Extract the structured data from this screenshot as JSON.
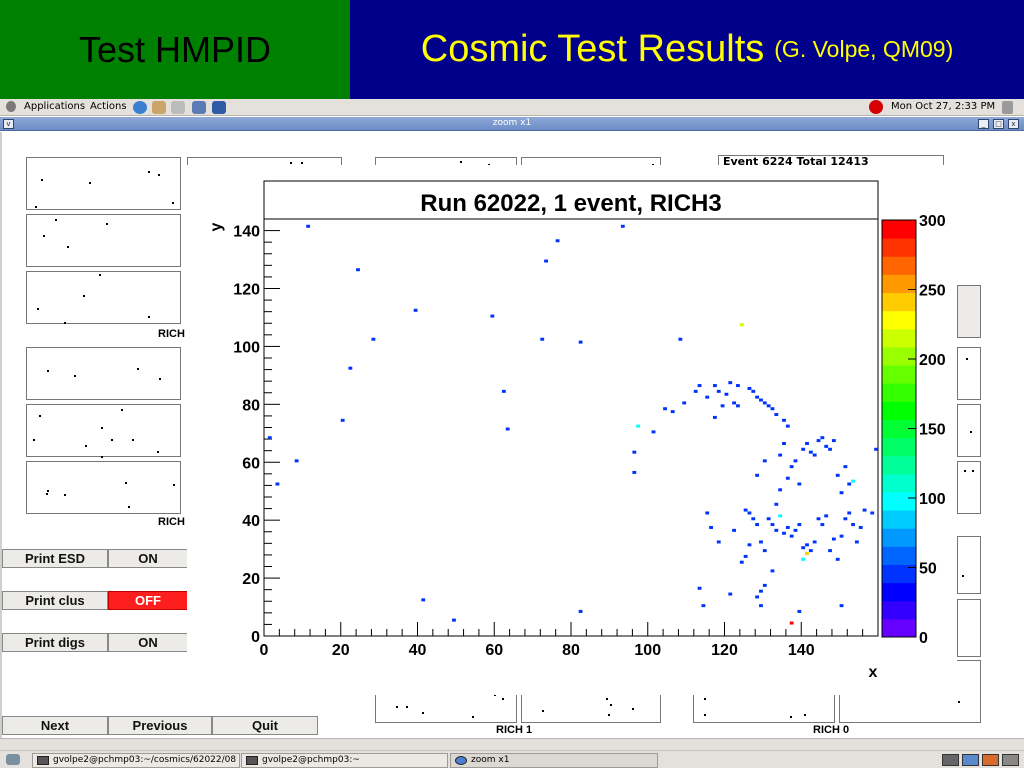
{
  "slide": {
    "left_title": "Test HMPID",
    "right_title": "Cosmic Test Results",
    "right_subtitle": "(G. Volpe, QM09)"
  },
  "panel": {
    "applications": "Applications",
    "actions": "Actions",
    "clock": "Mon Oct 27,  2:33 PM"
  },
  "window": {
    "title": "zoom x1"
  },
  "event_box": "Event 6224 Total 12413",
  "rich_labels": {
    "rich_top_left": "RICH",
    "rich_mid_left": "RICH",
    "rich_1": "RICH 1",
    "rich_0": "RICH 0"
  },
  "controls": [
    {
      "label": "Print ESD",
      "state": "ON",
      "state_color": "#ecebe8"
    },
    {
      "label": "Print clus",
      "state": "OFF",
      "state_color": "#ff1e1e"
    },
    {
      "label": "Print digs",
      "state": "ON",
      "state_color": "#ecebe8"
    }
  ],
  "nav": {
    "next": "Next",
    "previous": "Previous",
    "quit": "Quit"
  },
  "taskbar": {
    "items": [
      "gvolpe2@pchmp03:~/cosmics/62022/08",
      "gvolpe2@pchmp03:~",
      "zoom x1"
    ]
  },
  "chart_data": {
    "type": "scatter",
    "title": "Run 62022, 1 event, RICH3",
    "xlabel": "x",
    "ylabel": "y",
    "xlim": [
      0,
      160
    ],
    "ylim": [
      0,
      144
    ],
    "x_ticks": [
      0,
      20,
      40,
      60,
      80,
      100,
      120,
      140
    ],
    "y_ticks": [
      0,
      20,
      40,
      60,
      80,
      100,
      120,
      140
    ],
    "colorbar": {
      "range": [
        0,
        300
      ],
      "ticks": [
        0,
        50,
        100,
        150,
        200,
        250,
        300
      ],
      "colors": [
        "#6600ff",
        "#3300ff",
        "#0000ff",
        "#0033ff",
        "#0066ff",
        "#0099ff",
        "#00ccff",
        "#00ffff",
        "#00ffcc",
        "#00ff99",
        "#00ff66",
        "#00ff33",
        "#00ff00",
        "#33ff00",
        "#66ff00",
        "#99ff00",
        "#ccff00",
        "#ffff00",
        "#ffcc00",
        "#ff9900",
        "#ff6600",
        "#ff3300",
        "#ff0000"
      ]
    },
    "points": [
      [
        1,
        68,
        40
      ],
      [
        3,
        52,
        40
      ],
      [
        8,
        60,
        40
      ],
      [
        11,
        141,
        40
      ],
      [
        20,
        74,
        40
      ],
      [
        22,
        92,
        40
      ],
      [
        24,
        126,
        40
      ],
      [
        28,
        102,
        40
      ],
      [
        39,
        112,
        40
      ],
      [
        41,
        12,
        40
      ],
      [
        49,
        5,
        40
      ],
      [
        59,
        110,
        40
      ],
      [
        62,
        84,
        40
      ],
      [
        63,
        71,
        40
      ],
      [
        72,
        102,
        40
      ],
      [
        73,
        129,
        40
      ],
      [
        76,
        136,
        40
      ],
      [
        82,
        101,
        40
      ],
      [
        82,
        8,
        40
      ],
      [
        93,
        141,
        40
      ],
      [
        96,
        63,
        40
      ],
      [
        96,
        56,
        40
      ],
      [
        97,
        72,
        100
      ],
      [
        101,
        70,
        40
      ],
      [
        104,
        78,
        40
      ],
      [
        106,
        77,
        40
      ],
      [
        108,
        102,
        40
      ],
      [
        109,
        80,
        40
      ],
      [
        112,
        84,
        40
      ],
      [
        113,
        86,
        40
      ],
      [
        115,
        82,
        40
      ],
      [
        115,
        42,
        40
      ],
      [
        116,
        37,
        40
      ],
      [
        117,
        86,
        40
      ],
      [
        118,
        84,
        40
      ],
      [
        120,
        83,
        40
      ],
      [
        121,
        87,
        40
      ],
      [
        123,
        86,
        40
      ],
      [
        123,
        79,
        40
      ],
      [
        124,
        107,
        210
      ],
      [
        126,
        85,
        40
      ],
      [
        127,
        84,
        40
      ],
      [
        128,
        82,
        40
      ],
      [
        129,
        81,
        40
      ],
      [
        130,
        80,
        40
      ],
      [
        131,
        79,
        40
      ],
      [
        132,
        78,
        40
      ],
      [
        133,
        76,
        40
      ],
      [
        135,
        74,
        40
      ],
      [
        136,
        72,
        40
      ],
      [
        122,
        80,
        40
      ],
      [
        119,
        79,
        40
      ],
      [
        117,
        75,
        40
      ],
      [
        118,
        32,
        40
      ],
      [
        122,
        36,
        40
      ],
      [
        125,
        43,
        40
      ],
      [
        126,
        42,
        40
      ],
      [
        127,
        40,
        40
      ],
      [
        128,
        38,
        40
      ],
      [
        129,
        32,
        40
      ],
      [
        130,
        29,
        40
      ],
      [
        131,
        40,
        40
      ],
      [
        132,
        38,
        40
      ],
      [
        133,
        36,
        40
      ],
      [
        134,
        41,
        100
      ],
      [
        135,
        35,
        40
      ],
      [
        136,
        37,
        40
      ],
      [
        137,
        34,
        40
      ],
      [
        138,
        36,
        40
      ],
      [
        139,
        38,
        40
      ],
      [
        140,
        30,
        40
      ],
      [
        141,
        31,
        40
      ],
      [
        142,
        29,
        40
      ],
      [
        143,
        32,
        40
      ],
      [
        144,
        40,
        40
      ],
      [
        145,
        38,
        40
      ],
      [
        146,
        41,
        40
      ],
      [
        147,
        29,
        40
      ],
      [
        148,
        33,
        40
      ],
      [
        149,
        26,
        40
      ],
      [
        150,
        34,
        40
      ],
      [
        151,
        40,
        40
      ],
      [
        152,
        42,
        40
      ],
      [
        153,
        38,
        40
      ],
      [
        154,
        32,
        40
      ],
      [
        155,
        37,
        40
      ],
      [
        156,
        43,
        40
      ],
      [
        124,
        25,
        40
      ],
      [
        125,
        27,
        40
      ],
      [
        126,
        31,
        40
      ],
      [
        128,
        13,
        40
      ],
      [
        129,
        15,
        40
      ],
      [
        130,
        17,
        40
      ],
      [
        132,
        22,
        40
      ],
      [
        133,
        45,
        40
      ],
      [
        134,
        50,
        40
      ],
      [
        136,
        54,
        40
      ],
      [
        137,
        58,
        40
      ],
      [
        138,
        60,
        40
      ],
      [
        139,
        52,
        40
      ],
      [
        140,
        64,
        40
      ],
      [
        141,
        66,
        40
      ],
      [
        142,
        63,
        40
      ],
      [
        143,
        62,
        40
      ],
      [
        144,
        67,
        40
      ],
      [
        145,
        68,
        40
      ],
      [
        146,
        65,
        40
      ],
      [
        147,
        64,
        40
      ],
      [
        148,
        67,
        40
      ],
      [
        149,
        55,
        40
      ],
      [
        150,
        49,
        40
      ],
      [
        151,
        58,
        40
      ],
      [
        152,
        52,
        40
      ],
      [
        153,
        53,
        100
      ],
      [
        140,
        26,
        100
      ],
      [
        141,
        28,
        240
      ],
      [
        139,
        8,
        40
      ],
      [
        137,
        4,
        290
      ],
      [
        128,
        55,
        40
      ],
      [
        130,
        60,
        40
      ],
      [
        134,
        62,
        40
      ],
      [
        135,
        66,
        40
      ],
      [
        113,
        16,
        40
      ],
      [
        114,
        10,
        40
      ],
      [
        121,
        14,
        40
      ],
      [
        129,
        10,
        40
      ],
      [
        150,
        10,
        40
      ],
      [
        158,
        42,
        40
      ],
      [
        159,
        64,
        40
      ]
    ]
  }
}
